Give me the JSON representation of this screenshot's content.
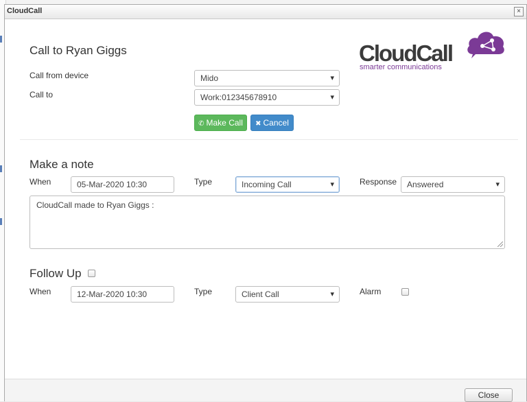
{
  "window": {
    "title": "CloudCall",
    "close_icon": "×"
  },
  "logo": {
    "wordmark": "CloudCall",
    "tagline": "smarter communications",
    "accent_color": "#7b3a96"
  },
  "call": {
    "heading": "Call to Ryan Giggs",
    "device_label": "Call from device",
    "device_value": "Mido",
    "callto_label": "Call to",
    "callto_value": "Work:012345678910",
    "make_call_label": "Make Call",
    "cancel_label": "Cancel"
  },
  "note": {
    "heading": "Make a note",
    "when_label": "When",
    "when_value": "05-Mar-2020 10:30",
    "type_label": "Type",
    "type_value": "Incoming Call",
    "response_label": "Response",
    "response_value": "Answered",
    "text": "CloudCall made to Ryan Giggs :"
  },
  "followup": {
    "heading": "Follow Up",
    "when_label": "When",
    "when_value": "12-Mar-2020 10:30",
    "type_label": "Type",
    "type_value": "Client Call",
    "alarm_label": "Alarm"
  },
  "footer": {
    "close_label": "Close"
  },
  "colors": {
    "make_call": "#5cb85c",
    "cancel": "#428bca",
    "highlight": "#e32222"
  }
}
